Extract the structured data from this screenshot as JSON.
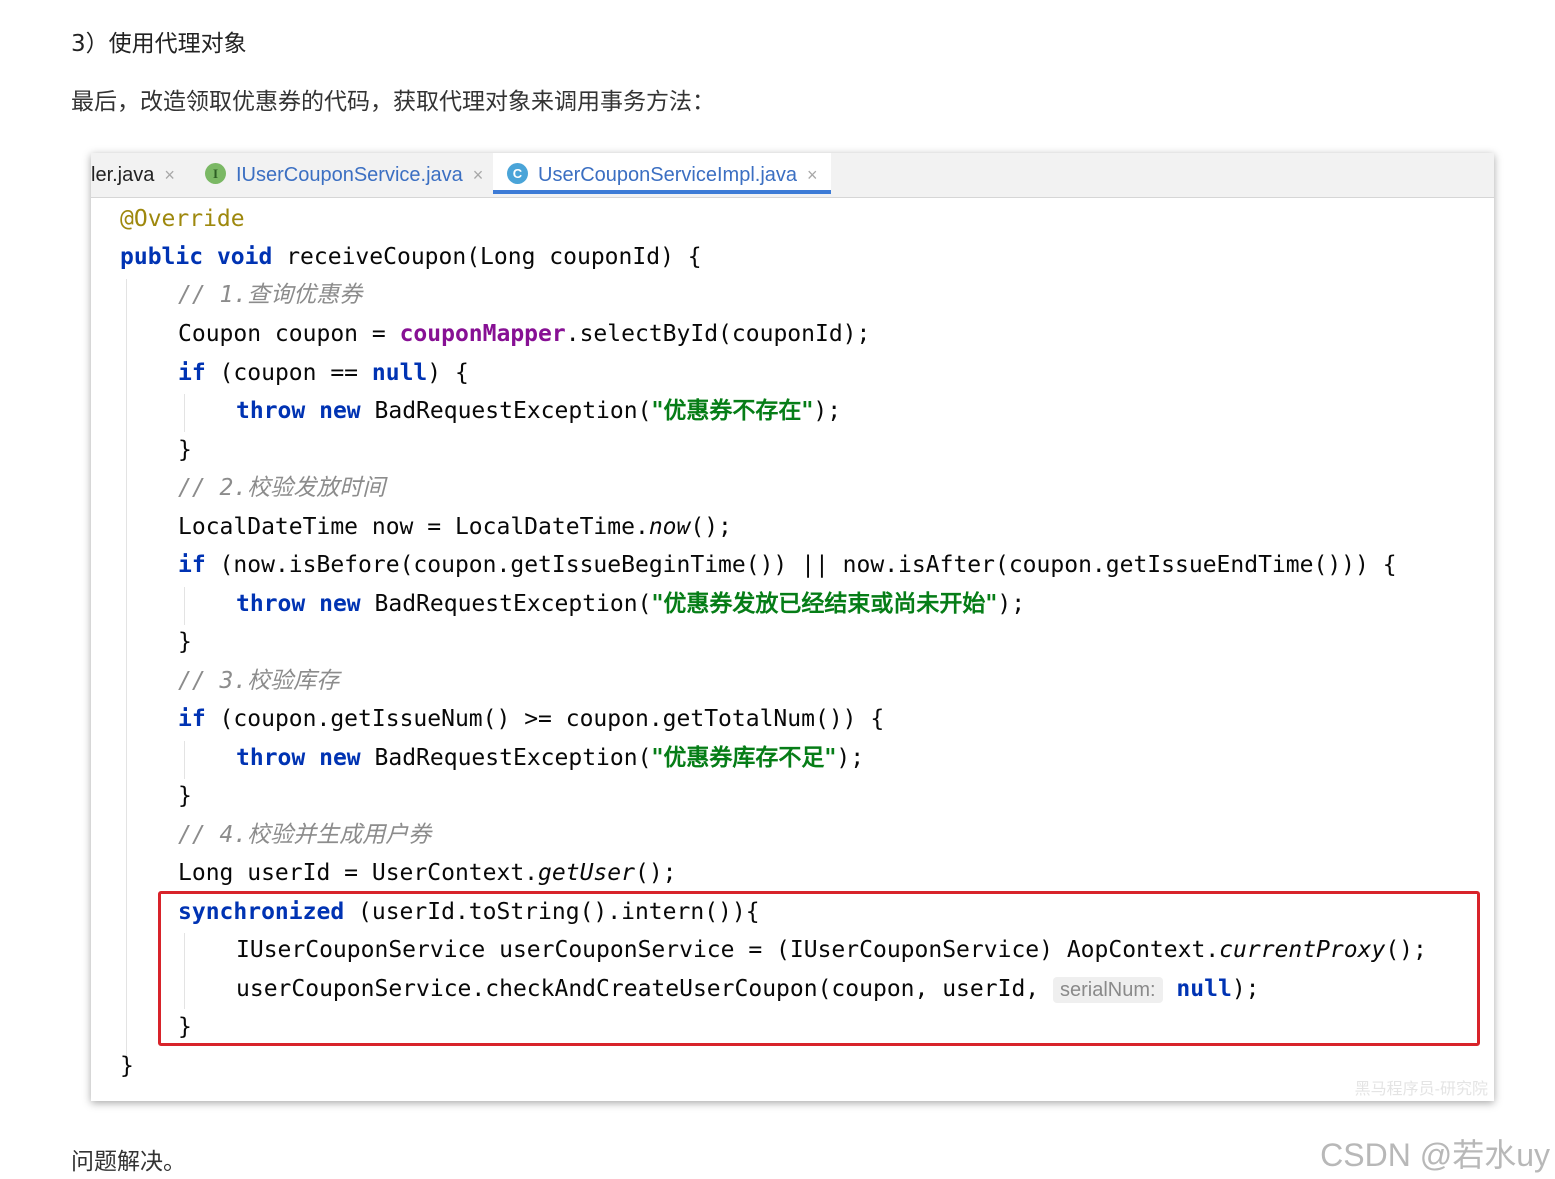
{
  "article": {
    "heading": "3）使用代理对象",
    "intro": "最后，改造领取优惠券的代码，获取代理对象来调用事务方法：",
    "outro": "问题解决。",
    "watermark": "CSDN @若水uy"
  },
  "editor": {
    "tabs": [
      {
        "label": "ler.java",
        "icon": null,
        "active": false
      },
      {
        "label": "IUserCouponService.java",
        "icon": "interface-icon",
        "icon_glyph": "I",
        "active": false
      },
      {
        "label": "UserCouponServiceImpl.java",
        "icon": "class-icon",
        "icon_glyph": "C",
        "active": true
      }
    ],
    "close_glyph": "×",
    "image_watermark": "黑马程序员-研究院",
    "code": {
      "l1_ann": "@Override",
      "l2_kw1": "public",
      "l2_kw2": "void",
      "l2_rest": " receiveCoupon(Long couponId) {",
      "l3_cmt": "// 1.查询优惠券",
      "l4_a": "Coupon coupon = ",
      "l4_field": "couponMapper",
      "l4_b": ".selectById(couponId);",
      "l5_kw": "if",
      "l5_a": " (coupon == ",
      "l5_kw2": "null",
      "l5_b": ") {",
      "l6_kw1": "throw",
      "l6_kw2": "new",
      "l6_a": " BadRequestException(",
      "l6_str": "\"优惠券不存在\"",
      "l6_b": ");",
      "l7": "}",
      "l8_cmt": "// 2.校验发放时间",
      "l9_a": "LocalDateTime now = LocalDateTime.",
      "l9_it": "now",
      "l9_b": "();",
      "l10_kw": "if",
      "l10_a": " (now.isBefore(coupon.getIssueBeginTime()) || now.isAfter(coupon.getIssueEndTime())) {",
      "l11_kw1": "throw",
      "l11_kw2": "new",
      "l11_a": " BadRequestException(",
      "l11_str": "\"优惠券发放已经结束或尚未开始\"",
      "l11_b": ");",
      "l12": "}",
      "l13_cmt": "// 3.校验库存",
      "l14_kw": "if",
      "l14_a": " (coupon.getIssueNum() >= coupon.getTotalNum()) {",
      "l15_kw1": "throw",
      "l15_kw2": "new",
      "l15_a": " BadRequestException(",
      "l15_str": "\"优惠券库存不足\"",
      "l15_b": ");",
      "l16": "}",
      "l17_cmt": "// 4.校验并生成用户券",
      "l18_a": "Long userId = UserContext.",
      "l18_it": "getUser",
      "l18_b": "();",
      "l19_kw": "synchronized",
      "l19_a": " (userId.toString().intern()){",
      "l20_a": "IUserCouponService userCouponService = (IUserCouponService) AopContext.",
      "l20_it": "currentProxy",
      "l20_b": "();",
      "l21_a": "userCouponService.checkAndCreateUserCoupon(coupon, userId, ",
      "l21_hint": "serialNum:",
      "l21_kw": "null",
      "l21_b": ");",
      "l22": "}",
      "l23": "}"
    }
  },
  "colors": {
    "keyword": "#0033b3",
    "annotation": "#9e880d",
    "field": "#871094",
    "string": "#067d17",
    "comment": "#8c8c8c",
    "highlight_border": "#d8232a",
    "active_tab_underline": "#3d7bd6"
  }
}
